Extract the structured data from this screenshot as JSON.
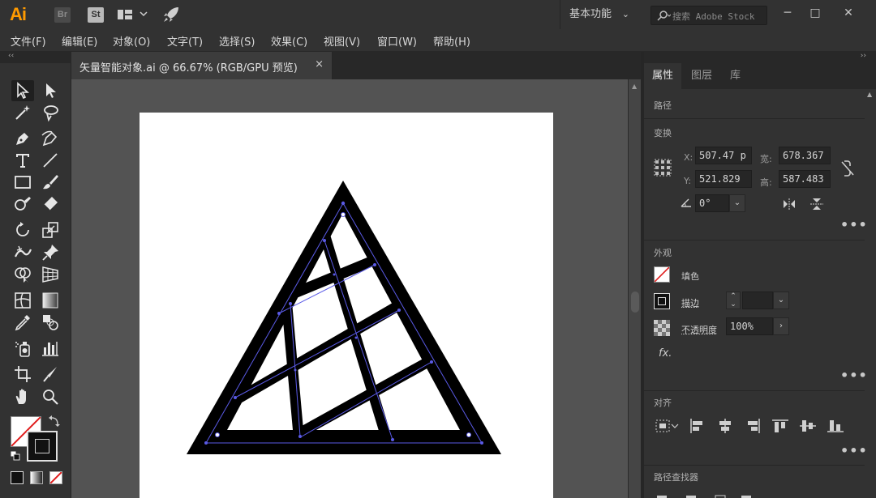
{
  "app": {
    "logo": "Ai",
    "bridge_badge": "Br",
    "stock_badge": "St"
  },
  "titlebar": {
    "workspace": "基本功能",
    "stock_search_placeholder": "搜索 Adobe Stock",
    "minimize": "─",
    "restore": "□",
    "close": "✕"
  },
  "menu": {
    "items": [
      "文件(F)",
      "编辑(E)",
      "对象(O)",
      "文字(T)",
      "选择(S)",
      "效果(C)",
      "视图(V)",
      "窗口(W)",
      "帮助(H)"
    ]
  },
  "toolstrip": {
    "collapse": "‹‹"
  },
  "document": {
    "tab_title": "矢量智能对象.ai @ 66.67% (RGB/GPU 预览)",
    "tab_close": "×"
  },
  "tools": [
    "selection-tool",
    "direct-selection-tool",
    "magic-wand-tool",
    "lasso-tool",
    "pen-tool",
    "curvature-tool",
    "type-tool",
    "line-segment-tool",
    "rectangle-tool",
    "paintbrush-tool",
    "shaper-tool",
    "eraser-tool",
    "rotate-tool",
    "scale-tool",
    "width-tool",
    "puppet-warp-tool",
    "shape-builder-tool",
    "perspective-grid-tool",
    "mesh-tool",
    "gradient-tool",
    "eyedropper-tool",
    "blend-tool",
    "symbol-sprayer-tool",
    "column-graph-tool",
    "artboard-tool",
    "slice-tool",
    "hand-tool",
    "zoom-tool"
  ],
  "panel": {
    "collapse": "››",
    "tabs": [
      "属性",
      "图层",
      "库"
    ],
    "active_tab": "属性",
    "path_title": "路径",
    "transform": {
      "title": "变换",
      "x_label": "X:",
      "x_value": "507.47 p",
      "y_label": "Y:",
      "y_value": "521.829",
      "w_label": "宽:",
      "w_value": "678.367",
      "h_label": "高:",
      "h_value": "587.483",
      "angle_value": "0°"
    },
    "appearance": {
      "title": "外观",
      "fill_label": "填色",
      "stroke_label": "描边",
      "opacity_label": "不透明度",
      "opacity_value": "100%",
      "fx_label": "fx."
    },
    "align_title": "对齐",
    "pathfinder_title": "路径查找器",
    "more": "•••"
  },
  "colors": {
    "ui_bg": "#323232",
    "canvas": "#535353",
    "artboard": "#ffffff",
    "selection": "#5a5ae6",
    "logo": "#ff9a00"
  }
}
